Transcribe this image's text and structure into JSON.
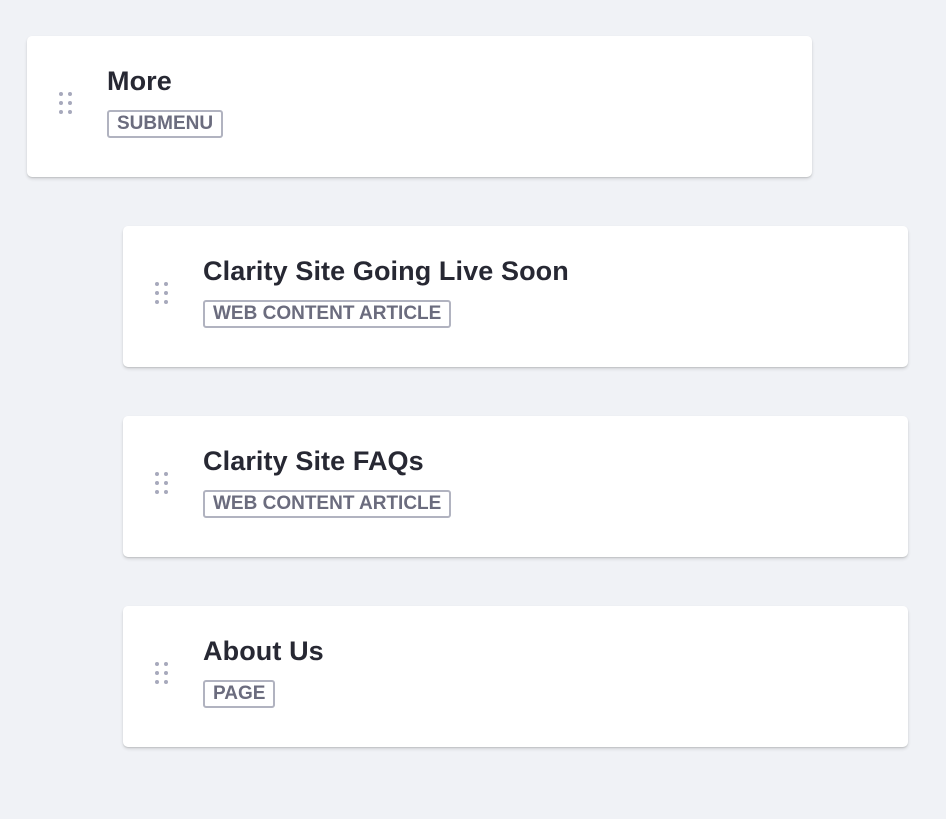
{
  "menu_items": [
    {
      "title": "More",
      "type": "SUBMENU"
    },
    {
      "title": "Clarity Site Going Live Soon",
      "type": "WEB CONTENT ARTICLE"
    },
    {
      "title": "Clarity Site FAQs",
      "type": "WEB CONTENT ARTICLE"
    },
    {
      "title": "About Us",
      "type": "PAGE"
    }
  ],
  "icons": {
    "drag_handle": "drag-handle-icon"
  },
  "colors": {
    "background": "#f0f2f6",
    "card": "#ffffff",
    "title": "#272833",
    "badge_text": "#6b6c7e",
    "badge_border": "#b1b3c0",
    "handle": "#a7a9bc"
  }
}
